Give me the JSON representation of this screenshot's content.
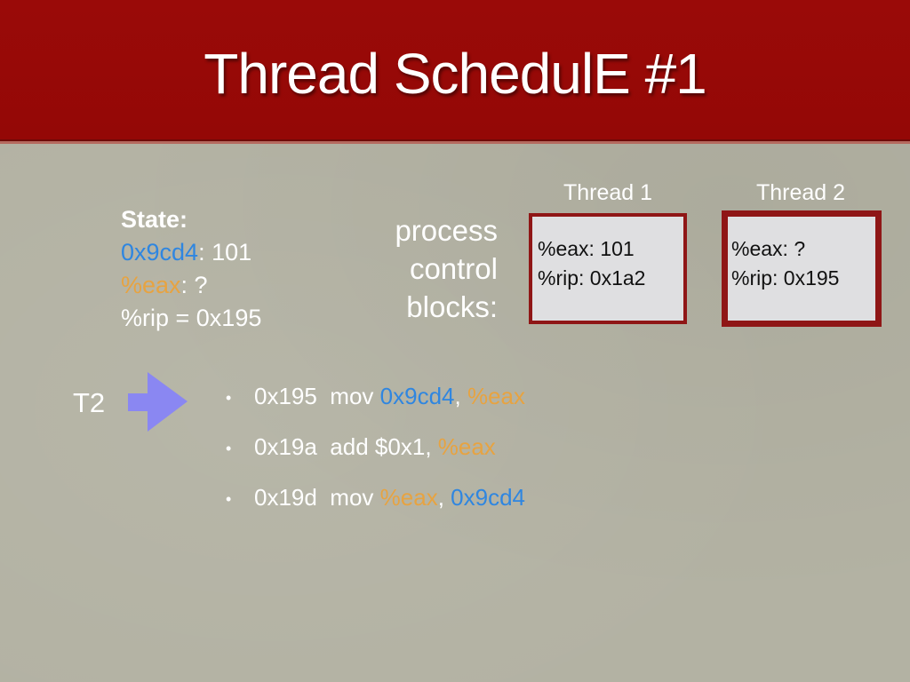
{
  "slide": {
    "title": "Thread SchedulE #1",
    "state": {
      "heading": "State:",
      "mem_addr": "0x9cd4",
      "mem_value": ": 101",
      "reg_name": "%eax",
      "reg_value": ": ?",
      "rip_line": "%rip = 0x195"
    },
    "pcb_label": [
      "process",
      "control",
      "blocks:"
    ],
    "threads": [
      {
        "label": "Thread 1",
        "eax": "%eax: 101",
        "rip": "%rip: 0x1a2"
      },
      {
        "label": "Thread 2",
        "eax": "%eax: ?",
        "rip": "%rip: 0x195"
      }
    ],
    "current_thread": "T2",
    "instructions": [
      {
        "bullet": "•",
        "addr": "0x195",
        "op": "mov",
        "arg1": "0x9cd4",
        "sep": ", ",
        "arg2": "%eax"
      },
      {
        "bullet": "•",
        "addr": "0x19a",
        "op": "add",
        "arg1": "$0x1",
        "sep": ", ",
        "arg2": "%eax"
      },
      {
        "bullet": "•",
        "addr": "0x19d",
        "op": "mov",
        "arg1": "%eax",
        "sep": ", ",
        "arg2": "0x9cd4"
      }
    ],
    "colors": {
      "header": "#940806",
      "address_blue": "#2f86e0",
      "register_orange": "#e7a341",
      "arrow": "#8a87f2",
      "pcb_border": "#8f1616"
    }
  }
}
